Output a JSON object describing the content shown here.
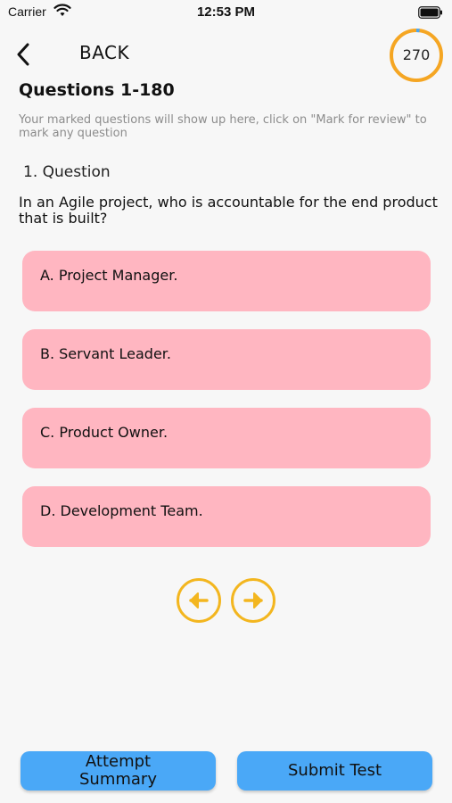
{
  "status_bar": {
    "carrier": "Carrier",
    "time": "12:53 PM"
  },
  "header": {
    "back_label": "BACK",
    "timer_value": "270",
    "timer_progress": 0.02
  },
  "page": {
    "title": "Questions 1-180",
    "hint": "Your marked questions will show up here, click on \"Mark for review\" to mark any question"
  },
  "question": {
    "number_label": "1. Question",
    "text": "In an Agile project, who is accountable for the end product that is built?",
    "options": [
      "A. Project Manager.",
      "B.  Servant Leader.",
      "C.  Product Owner.",
      "D.  Development Team."
    ]
  },
  "footer": {
    "summary_line1": "Attempt",
    "summary_line2": "Summary",
    "submit_label": "Submit Test"
  },
  "colors": {
    "option_bg": "#ffb6c1",
    "accent_yellow": "#f3b61f",
    "timer_ring": "#f5a623",
    "timer_progress": "#4aa8f7",
    "button_blue": "#4aa8f7"
  }
}
